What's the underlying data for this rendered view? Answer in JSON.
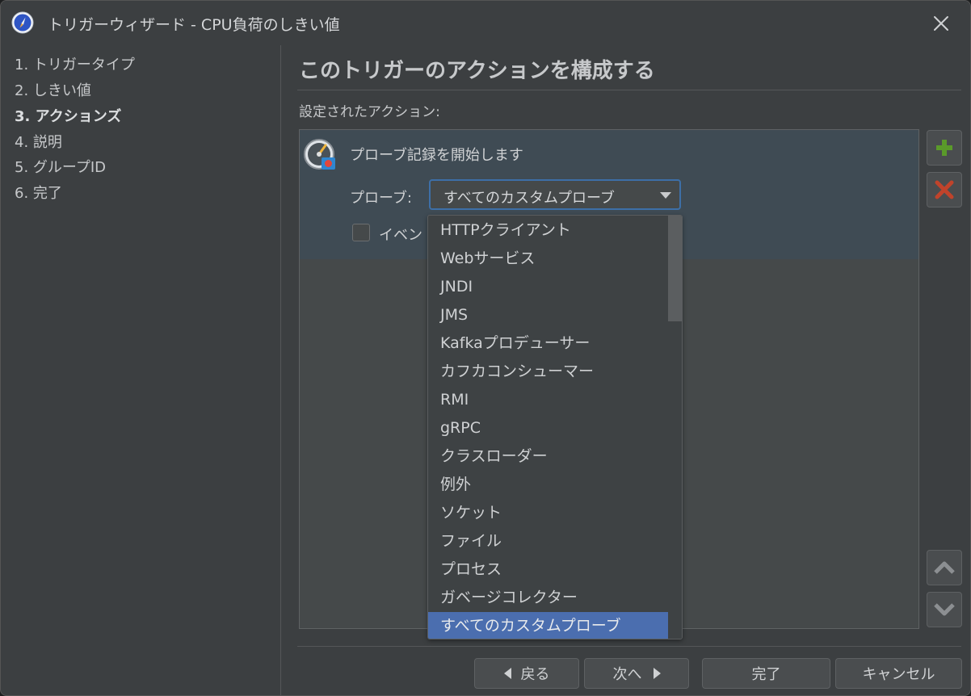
{
  "window": {
    "title": "トリガーウィザード - CPU負荷のしきい値"
  },
  "steps": [
    {
      "label": "1. トリガータイプ",
      "active": false
    },
    {
      "label": "2. しきい値",
      "active": false
    },
    {
      "label": "3. アクションズ",
      "active": true
    },
    {
      "label": "4. 説明",
      "active": false
    },
    {
      "label": "5. グループID",
      "active": false
    },
    {
      "label": "6. 完了",
      "active": false
    }
  ],
  "main": {
    "heading": "このトリガーのアクションを構成する",
    "configured_label": "設定されたアクション:"
  },
  "action": {
    "title": "プローブ記録を開始します",
    "probe_label": "プローブ:",
    "probe_value": "すべてのカスタムプローブ",
    "checkbox_label": "イベン",
    "checkbox_checked": false
  },
  "dropdown": {
    "options": [
      "HTTPクライアント",
      "Webサービス",
      "JNDI",
      "JMS",
      "Kafkaプロデューサー",
      "カフカコンシューマー",
      "RMI",
      "gRPC",
      "クラスローダー",
      "例外",
      "ソケット",
      "ファイル",
      "プロセス",
      "ガベージコレクター",
      "すべてのカスタムプローブ"
    ],
    "selected_index": 14
  },
  "icons": {
    "add": "plus-icon",
    "remove": "delete-x-icon",
    "up": "chevron-up-icon",
    "down": "chevron-down-icon",
    "close": "close-icon"
  },
  "colors": {
    "background": "#3c3f41",
    "selection": "#4b6eaf",
    "add_green": "#5a9a2a",
    "remove_red": "#c0432b",
    "focus_border": "#3d6fa7"
  },
  "footer": {
    "back": "戻る",
    "next": "次へ",
    "finish": "完了",
    "cancel": "キャンセル"
  }
}
